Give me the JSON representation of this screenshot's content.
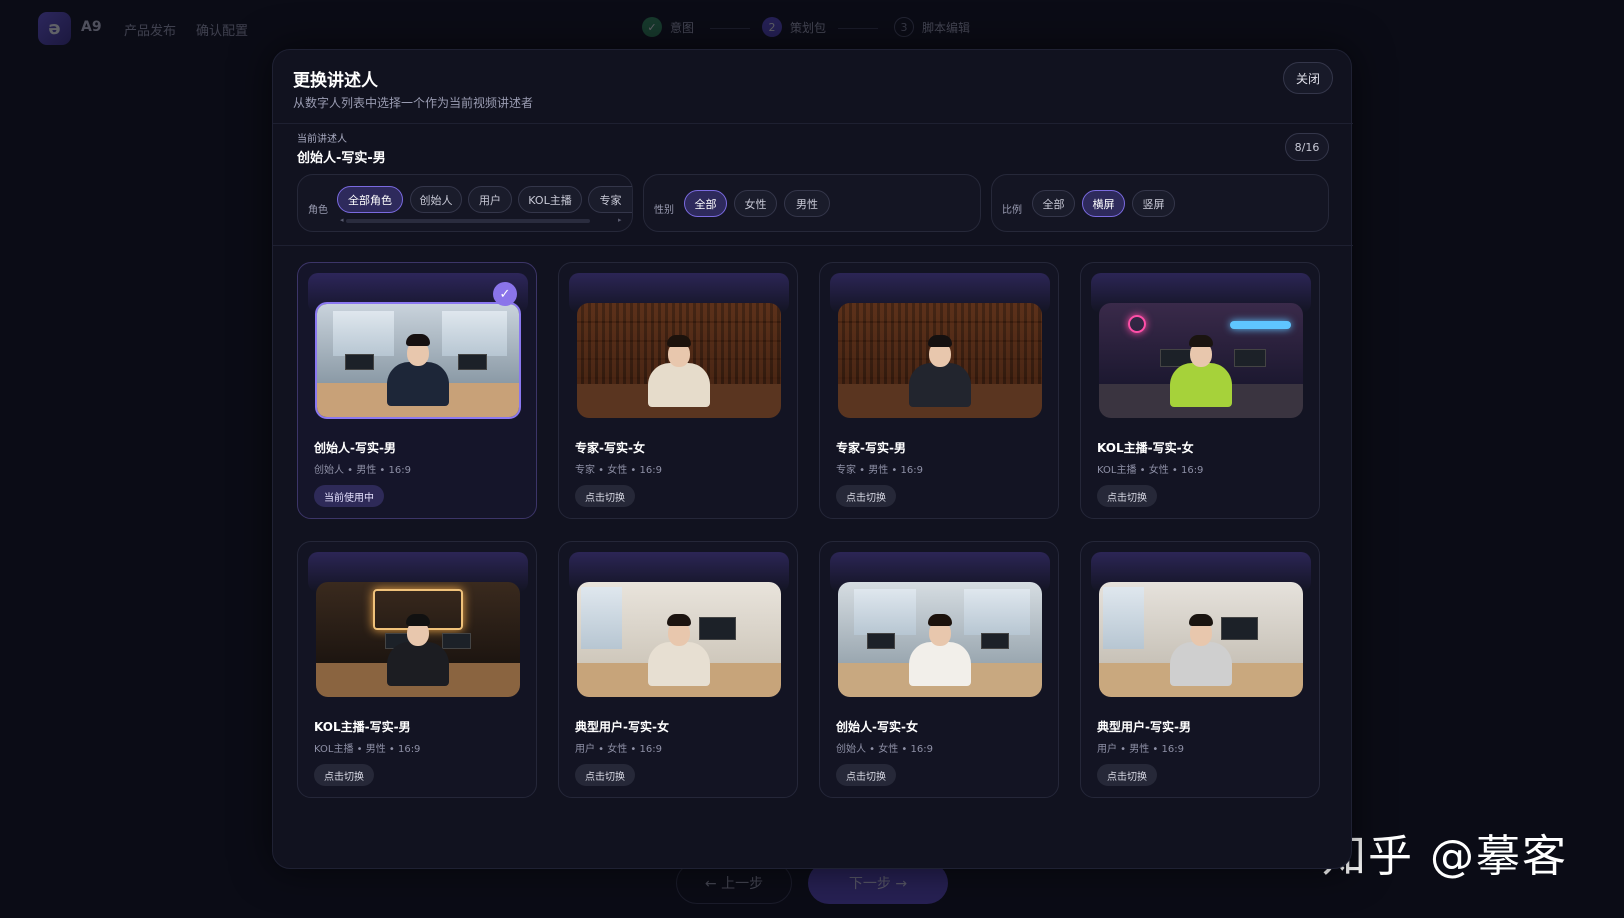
{
  "app": {
    "brand": "A9",
    "logo_glyph": "ə",
    "nav": [
      "产品发布",
      "确认配置"
    ],
    "steps": [
      {
        "num": "✓",
        "label": "意图"
      },
      {
        "num": "2",
        "label": "策划包"
      },
      {
        "num": "3",
        "label": "脚本编辑"
      }
    ],
    "prev_button": "← 上一步",
    "next_button": "下一步 →"
  },
  "watermark": "知乎 @摹客",
  "modal": {
    "title": "更换讲述人",
    "subtitle": "从数字人列表中选择一个作为当前视频讲述者",
    "close_label": "关闭",
    "current_label": "当前讲述人",
    "current_name": "创始人-写实-男",
    "count": "8/16"
  },
  "filters": {
    "role": {
      "label": "角色",
      "options": [
        "全部角色",
        "创始人",
        "用户",
        "KOL主播",
        "专家"
      ],
      "selected": "全部角色"
    },
    "gender": {
      "label": "性别",
      "options": [
        "全部",
        "女性",
        "男性"
      ],
      "selected": "全部"
    },
    "ratio": {
      "label": "比例",
      "options": [
        "全部",
        "横屏",
        "竖屏"
      ],
      "selected": "横屏"
    }
  },
  "cards": [
    {
      "name": "创始人-写实-男",
      "meta": "创始人 • 男性 • 16:9",
      "button": "当前使用中",
      "selected": true,
      "scene": "office-male"
    },
    {
      "name": "专家-写实-女",
      "meta": "专家 • 女性 • 16:9",
      "button": "点击切换",
      "selected": false,
      "scene": "library-female"
    },
    {
      "name": "专家-写实-男",
      "meta": "专家 • 男性 • 16:9",
      "button": "点击切换",
      "selected": false,
      "scene": "library-male"
    },
    {
      "name": "KOL主播-写实-女",
      "meta": "KOL主播 • 女性 • 16:9",
      "button": "点击切换",
      "selected": false,
      "scene": "neon-studio-female"
    },
    {
      "name": "KOL主播-写实-男",
      "meta": "KOL主播 • 男性 • 16:9",
      "button": "点击切换",
      "selected": false,
      "scene": "studio-male"
    },
    {
      "name": "典型用户-写实-女",
      "meta": "用户 • 女性 • 16:9",
      "button": "点击切换",
      "selected": false,
      "scene": "home-office-female"
    },
    {
      "name": "创始人-写实-女",
      "meta": "创始人 • 女性 • 16:9",
      "button": "点击切换",
      "selected": false,
      "scene": "office-female"
    },
    {
      "name": "典型用户-写实-男",
      "meta": "用户 • 男性 • 16:9",
      "button": "点击切换",
      "selected": false,
      "scene": "home-office-male"
    }
  ],
  "colors": {
    "accent": "#8a74ea",
    "background": "#0b0c16",
    "modal": "#11121f"
  }
}
